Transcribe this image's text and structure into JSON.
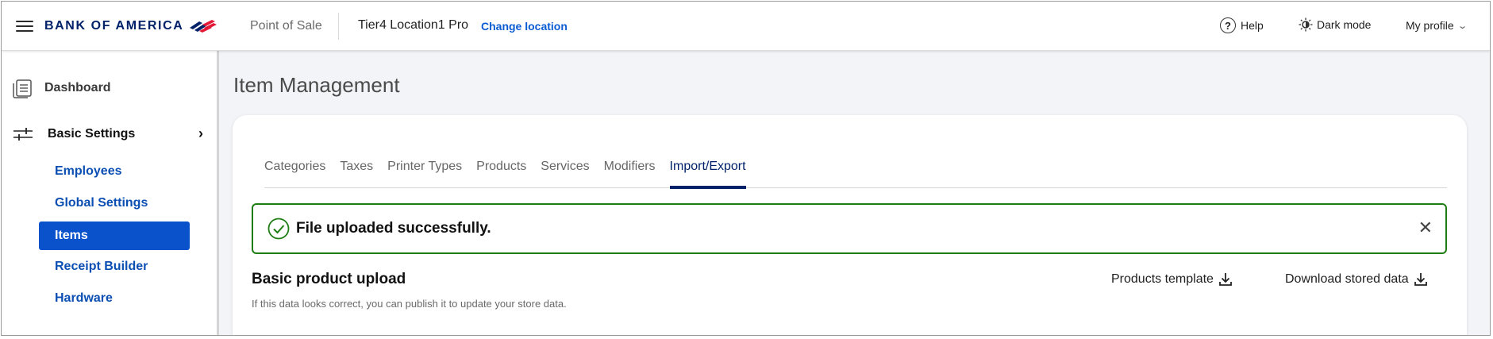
{
  "header": {
    "brand": "BANK OF AMERICA",
    "app_name": "Point of Sale",
    "location": "Tier4 Location1 Pro",
    "change_location": "Change location",
    "help": "Help",
    "dark_mode": "Dark mode",
    "profile": "My profile"
  },
  "sidebar": {
    "dashboard": "Dashboard",
    "basic_settings": "Basic Settings",
    "items": [
      {
        "label": "Employees",
        "active": false
      },
      {
        "label": "Global Settings",
        "active": false
      },
      {
        "label": "Items",
        "active": true
      },
      {
        "label": "Receipt Builder",
        "active": false
      },
      {
        "label": "Hardware",
        "active": false
      }
    ]
  },
  "main": {
    "title": "Item Management",
    "tabs": [
      {
        "label": "Categories",
        "active": false
      },
      {
        "label": "Taxes",
        "active": false
      },
      {
        "label": "Printer Types",
        "active": false
      },
      {
        "label": "Products",
        "active": false
      },
      {
        "label": "Services",
        "active": false
      },
      {
        "label": "Modifiers",
        "active": false
      },
      {
        "label": "Import/Export",
        "active": true
      }
    ],
    "alert": {
      "message": "File uploaded successfully.",
      "color": "#1e7e14"
    },
    "section": {
      "title": "Basic product upload",
      "subtitle": "If this data looks correct, you can publish it to update your store data.",
      "products_template": "Products template",
      "download_stored": "Download stored data"
    }
  },
  "colors": {
    "brand_navy": "#012169",
    "brand_red": "#e31837",
    "link_blue": "#0b5bd3",
    "active_blue": "#0a52cc",
    "success_green": "#1e7e14"
  }
}
